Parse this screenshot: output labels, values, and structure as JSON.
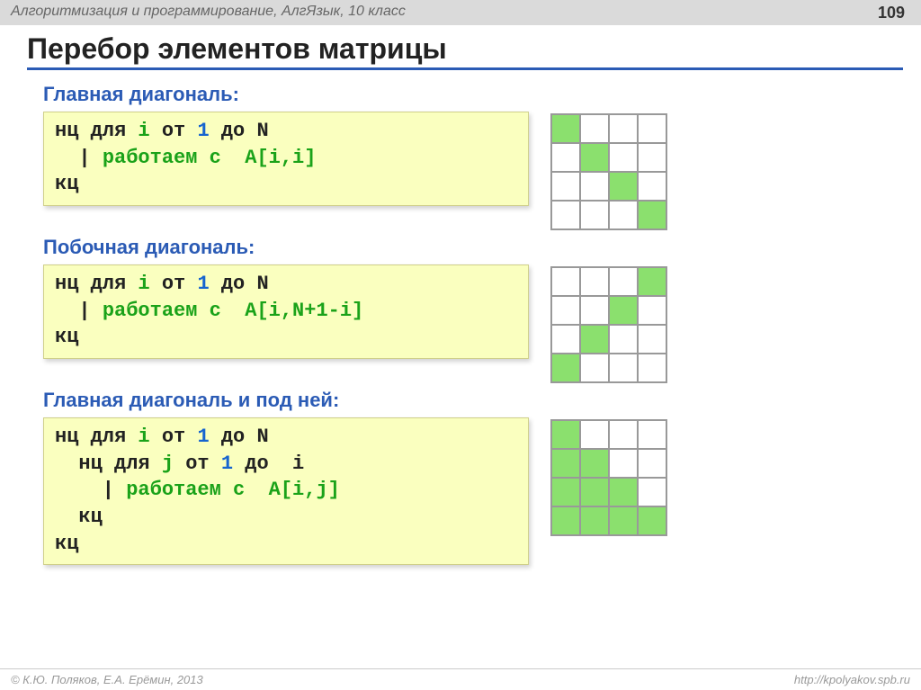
{
  "header": {
    "course": "Алгоритмизация и программирование, АлгЯзык, 10 класс",
    "page": "109"
  },
  "title": "Перебор элементов матрицы",
  "sections": [
    {
      "heading": "Главная диагональ:",
      "code": {
        "l0a": "нц для ",
        "l0b": "i",
        "l0c": " от ",
        "l0d": "1",
        "l0e": " до N",
        "l1a": "  | ",
        "l1b": "работаем с  A[i,i]",
        "l2a": "кц"
      },
      "matrix_type": "main"
    },
    {
      "heading": "Побочная диагональ:",
      "code": {
        "l0a": "нц для ",
        "l0b": "i",
        "l0c": " от ",
        "l0d": "1",
        "l0e": " до N",
        "l1a": "  | ",
        "l1b": "работаем с  A[i,N+1-i]",
        "l2a": "кц"
      },
      "matrix_type": "anti"
    },
    {
      "heading": "Главная диагональ и под ней:",
      "code": {
        "l0a": "нц для ",
        "l0b": "i",
        "l0c": " от ",
        "l0d": "1",
        "l0e": " до N",
        "l1a": "  нц для ",
        "l1b": "j",
        "l1c": " от ",
        "l1d": "1",
        "l1e": " до  i",
        "l2a": "    | ",
        "l2b": "работаем с  A[i,j]",
        "l3a": "  кц",
        "l4a": "кц"
      },
      "matrix_type": "lower"
    }
  ],
  "footer": {
    "left": "© К.Ю. Поляков, Е.А. Ерёмин, 2013",
    "right": "http://kpolyakov.spb.ru"
  }
}
